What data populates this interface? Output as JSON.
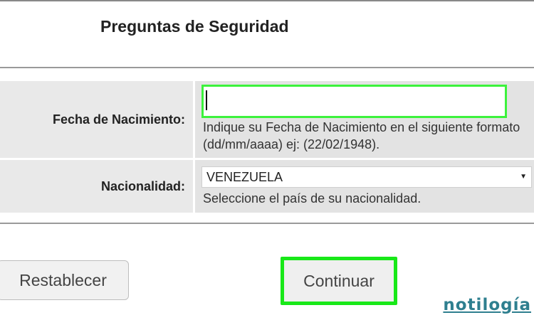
{
  "header": {
    "title": "Preguntas de Seguridad"
  },
  "form": {
    "fecha": {
      "label": "Fecha de Nacimiento:",
      "value": "",
      "hint": "Indique su Fecha de Nacimiento en el siguiente formato (dd/mm/aaaa) ej: (22/02/1948)."
    },
    "nacionalidad": {
      "label": "Nacionalidad:",
      "selected": "VENEZUELA",
      "hint": "Seleccione el país de su nacionalidad."
    }
  },
  "actions": {
    "reset_label": "Restablecer",
    "continue_label": "Continuar"
  },
  "watermark": {
    "text": "notilogía"
  },
  "colors": {
    "focus_green": "#3cf23c",
    "highlight_green": "#18e818",
    "watermark": "#2e7f8f"
  },
  "icons": {
    "select_arrow": "chevron-down-icon"
  }
}
